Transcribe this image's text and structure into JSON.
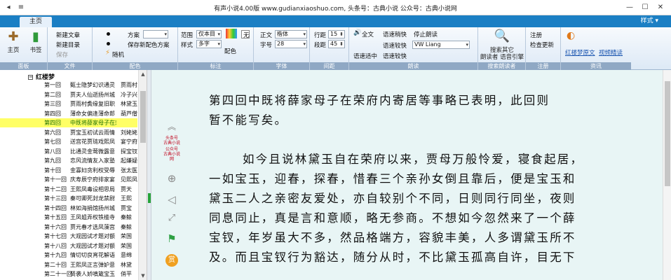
{
  "window": {
    "title": "有声小说4.00版 www.gudianxiaoshuo.com, 头条号：古典小说 公众号：古典小说网",
    "minimize": "—",
    "maximize": "☐",
    "close": "✕",
    "qa_back": "◂",
    "qa_menu": "≡"
  },
  "tabs": {
    "main": "主页",
    "style_menu": "样式 ▾"
  },
  "ribbon": {
    "panel": {
      "label": "面板",
      "homepage": "主页",
      "bookmark": "书签"
    },
    "file": {
      "label": "文件",
      "new_file": "新建文章",
      "new_dir": "新建目录",
      "save": "保存"
    },
    "color": {
      "label": "配色",
      "scheme": "方案",
      "save_scheme": "保存新配色方案",
      "random": "随机"
    },
    "markup": {
      "label": "标注",
      "range_label": "范围",
      "range_value": "仅本目",
      "style_label": "样式",
      "style_value": "多字",
      "color_btn": "配色",
      "none_btn": "无"
    },
    "font": {
      "label": "字体",
      "body_label": "正文",
      "body_value": "楷体",
      "size_label": "字号",
      "size_value": "28"
    },
    "spacing": {
      "label": "间距",
      "line_label": "行距",
      "line_value": "15",
      "para_label": "段距",
      "para_value": "45"
    },
    "read": {
      "label": "朗读",
      "full": "全文",
      "fit": "语速适中",
      "rate_down": "语速稍快",
      "rate_up": "语速较快",
      "rate_slower": "语速较快",
      "stop": "停止朗读",
      "voice_value": "VW Liang"
    },
    "search": {
      "label": "搜索朗读者",
      "btn_line1": "搜索其它",
      "btn_line2": "朗读者 语音引擎"
    },
    "register": {
      "label": "注册",
      "register": "注册",
      "check": "检查更新"
    },
    "info": {
      "label": "资讯",
      "link1": "红楼梦原文",
      "link2": "视频精读"
    }
  },
  "tree": {
    "root": "红楼梦",
    "rows": [
      {
        "ch": "第一回",
        "t1": "甄士隐梦幻识通灵",
        "t2": "贾雨村"
      },
      {
        "ch": "第二回",
        "t1": "贾夫人仙逝扬州城",
        "t2": "冷子兴"
      },
      {
        "ch": "第三回",
        "t1": "贾雨村夤缘复旧职",
        "t2": "林黛玉"
      },
      {
        "ch": "第四回",
        "t1": "薄命女偏逢薄命郎",
        "t2": "葫芦僧"
      },
      {
        "ch": "第四回",
        "t1": "中既将薛家母子在荣府内寄居",
        "t2": "",
        "selected": true
      },
      {
        "ch": "第六回",
        "t1": "贾宝玉初试云雨情",
        "t2": "刘姥姥"
      },
      {
        "ch": "第七回",
        "t1": "送宫花贾琏戏熙凤",
        "t2": "宴宁府"
      },
      {
        "ch": "第八回",
        "t1": "比通灵金莺微露意",
        "t2": "探宝钗"
      },
      {
        "ch": "第九回",
        "t1": "恋风流情友入家塾",
        "t2": "起嫌疑"
      },
      {
        "ch": "第十回",
        "t1": "金寡妇贪利权受辱",
        "t2": "张太医"
      },
      {
        "ch": "第十一回",
        "t1": "庆寿辰宁府排家宴",
        "t2": "见熙凤"
      },
      {
        "ch": "第十二回",
        "t1": "王熙凤毒设相思局",
        "t2": "贾天"
      },
      {
        "ch": "第十三回",
        "t1": "秦可卿死封龙禁尉",
        "t2": "王熙"
      },
      {
        "ch": "第十四回",
        "t1": "林如海捐馆扬州城",
        "t2": "贾宝"
      },
      {
        "ch": "第十五回",
        "t1": "王凤姐弄权铁槛寺",
        "t2": "秦鲸"
      },
      {
        "ch": "第十六回",
        "t1": "贾元春才选凤藻宫",
        "t2": "秦鲸"
      },
      {
        "ch": "第十七回",
        "t1": "大观园试才题对额",
        "t2": "荣国"
      },
      {
        "ch": "第十八回",
        "t1": "大观园试才题对额",
        "t2": "荣国"
      },
      {
        "ch": "第十九回",
        "t1": "情切切良宵花解语",
        "t2": "意绵"
      },
      {
        "ch": "第二十回",
        "t1": "王熙凤正言弹妒意",
        "t2": "林黛"
      },
      {
        "ch": "第二十一回",
        "t1": "贤袭人娇嗔箴宝玉",
        "t2": "俏平"
      }
    ]
  },
  "reader": {
    "paragraphs": [
      [
        "第四回中既将薛家母子在荣府内寄居等事略已表明，此回则",
        "暂不能写矣。"
      ],
      [
        "如今且说林黛玉自在荣府以来，贾母万般怜爱，寝食起居，",
        "一如宝玉，迎春，探春，惜春三个亲孙女倒且靠后，便是宝玉和",
        "黛玉二人之亲密友爱处，亦自较别个不同，日则同行同坐，夜则",
        "同息同止，真是言和意顺，略无参商。不想如今忽然来了一个薛",
        "宝钗，年岁虽大不多，然品格端方，容貌丰美，人多谓黛玉所不",
        "及。而且宝钗行为豁达，随分从时，不比黛玉孤高自许，目无下"
      ]
    ],
    "seal_line1": "头条号",
    "seal_line2": "古典小说",
    "seal_line3": "公众号",
    "seal_line4": "古典小说网",
    "reward": "赏"
  },
  "colors": {
    "accent": "#1b7fc4",
    "selected_row": "#ffff66",
    "reader_bg": "#e8f5f5",
    "seal_red": "#c0001a"
  }
}
